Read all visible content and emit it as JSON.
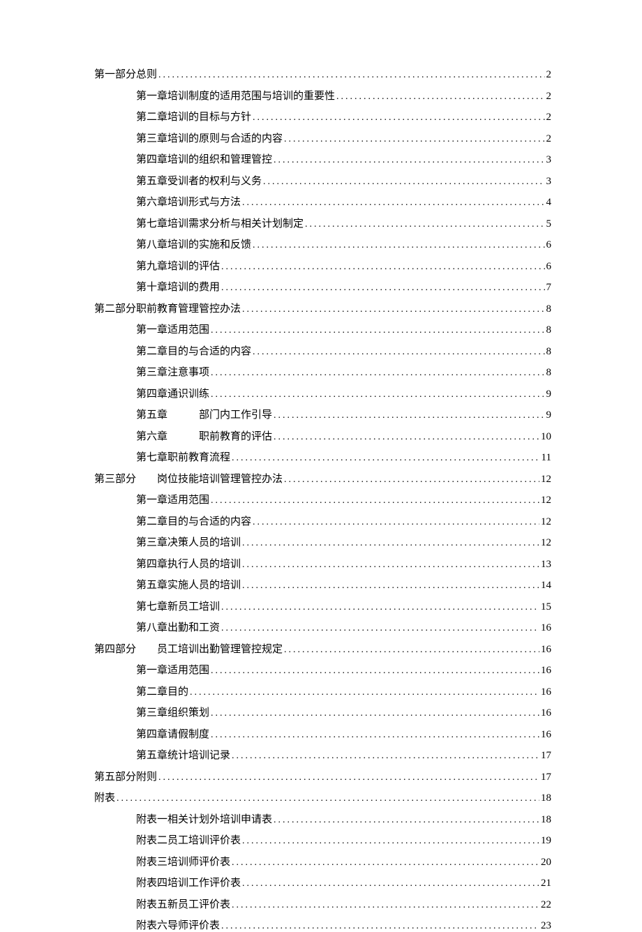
{
  "toc": [
    {
      "level": 0,
      "prefix": "第一部分",
      "gap": "",
      "title": "总则",
      "page": "2"
    },
    {
      "level": 1,
      "prefix": "第一章",
      "gap": "",
      "title": "培训制度的适用范围与培训的重要性",
      "page": "2"
    },
    {
      "level": 1,
      "prefix": "第二章",
      "gap": "",
      "title": "培训的目标与方针",
      "page": "2"
    },
    {
      "level": 1,
      "prefix": "第三章",
      "gap": "",
      "title": "培训的原则与合适的内容",
      "page": "2"
    },
    {
      "level": 1,
      "prefix": "第四章",
      "gap": "",
      "title": "培训的组织和管理管控",
      "page": "3"
    },
    {
      "level": 1,
      "prefix": "第五章",
      "gap": "",
      "title": "受训者的权利与义务",
      "page": "3"
    },
    {
      "level": 1,
      "prefix": "第六章",
      "gap": "",
      "title": "培训形式与方法",
      "page": "4"
    },
    {
      "level": 1,
      "prefix": "第七章",
      "gap": "",
      "title": "培训需求分析与相关计划制定",
      "page": "5"
    },
    {
      "level": 1,
      "prefix": "第八章",
      "gap": "",
      "title": "培训的实施和反馈",
      "page": "6"
    },
    {
      "level": 1,
      "prefix": "第九章",
      "gap": "",
      "title": "培训的评估",
      "page": "6"
    },
    {
      "level": 1,
      "prefix": "第十章",
      "gap": "",
      "title": "培训的费用",
      "page": "7"
    },
    {
      "level": 0,
      "prefix": "第二部分",
      "gap": "",
      "title": "职前教育管理管控办法",
      "page": "8"
    },
    {
      "level": 1,
      "prefix": "第一章",
      "gap": "",
      "title": "适用范围",
      "page": "8"
    },
    {
      "level": 1,
      "prefix": "第二章",
      "gap": "",
      "title": "目的与合适的内容",
      "page": "8"
    },
    {
      "level": 1,
      "prefix": "第三章",
      "gap": "",
      "title": "注意事项",
      "page": "8"
    },
    {
      "level": 1,
      "prefix": "第四章",
      "gap": "",
      "title": "通识训练",
      "page": "9"
    },
    {
      "level": 1,
      "prefix": "第五章",
      "gap": "   ",
      "title": "部门内工作引导",
      "page": "9"
    },
    {
      "level": 1,
      "prefix": "第六章",
      "gap": "   ",
      "title": "职前教育的评估",
      "page": "10"
    },
    {
      "level": 1,
      "prefix": "第七章",
      "gap": "",
      "title": "职前教育流程",
      "page": "11"
    },
    {
      "level": 0,
      "prefix": "第三部分",
      "gap": "  ",
      "title": "岗位技能培训管理管控办法",
      "page": "12"
    },
    {
      "level": 1,
      "prefix": "第一章",
      "gap": "",
      "title": "适用范围",
      "page": "12"
    },
    {
      "level": 1,
      "prefix": "第二章",
      "gap": "",
      "title": "目的与合适的内容",
      "page": "12"
    },
    {
      "level": 1,
      "prefix": "第三章",
      "gap": "",
      "title": "决策人员的培训",
      "page": "12"
    },
    {
      "level": 1,
      "prefix": "第四章",
      "gap": "",
      "title": "执行人员的培训",
      "page": "13"
    },
    {
      "level": 1,
      "prefix": "第五章",
      "gap": "",
      "title": "实施人员的培训",
      "page": "14"
    },
    {
      "level": 1,
      "prefix": "第七章",
      "gap": "",
      "title": "新员工培训",
      "page": "15"
    },
    {
      "level": 1,
      "prefix": "第八章",
      "gap": "",
      "title": "出勤和工资",
      "page": "16"
    },
    {
      "level": 0,
      "prefix": "第四部分",
      "gap": "  ",
      "title": "员工培训出勤管理管控规定",
      "page": "16"
    },
    {
      "level": 1,
      "prefix": "第一章",
      "gap": "",
      "title": "适用范围",
      "page": "16"
    },
    {
      "level": 1,
      "prefix": "第二章",
      "gap": "",
      "title": "目的",
      "page": "16"
    },
    {
      "level": 1,
      "prefix": "第三章",
      "gap": "",
      "title": "组织策划",
      "page": "16"
    },
    {
      "level": 1,
      "prefix": "第四章",
      "gap": "",
      "title": "请假制度",
      "page": "16"
    },
    {
      "level": 1,
      "prefix": "第五章",
      "gap": "",
      "title": "统计培训记录",
      "page": "17"
    },
    {
      "level": 0,
      "prefix": "第五部分",
      "gap": "",
      "title": "附则",
      "page": "17"
    },
    {
      "level": 0,
      "prefix": "附表",
      "gap": "",
      "title": "",
      "page": "18"
    },
    {
      "level": 1,
      "prefix": "附表一",
      "gap": "",
      "title": "相关计划外培训申请表",
      "page": "18"
    },
    {
      "level": 1,
      "prefix": "附表二",
      "gap": "",
      "title": "员工培训评价表",
      "page": "19"
    },
    {
      "level": 1,
      "prefix": "附表三",
      "gap": "",
      "title": "培训师评价表",
      "page": "20"
    },
    {
      "level": 1,
      "prefix": "附表四",
      "gap": "",
      "title": "培训工作评价表",
      "page": "21"
    },
    {
      "level": 1,
      "prefix": "附表五",
      "gap": "",
      "title": "新员工评价表",
      "page": "22"
    },
    {
      "level": 1,
      "prefix": "附表六",
      "gap": "",
      "title": "导师评价表",
      "page": "23"
    }
  ]
}
